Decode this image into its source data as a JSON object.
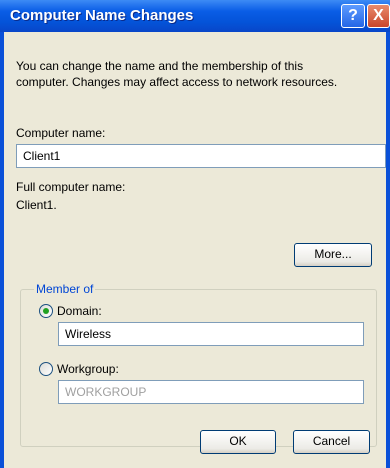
{
  "window": {
    "title": "Computer Name Changes",
    "help_label": "?",
    "close_label": "X"
  },
  "description": {
    "line1": "You can change the name and the membership of this",
    "line2": "computer. Changes may affect access to network resources."
  },
  "computer_name": {
    "label": "Computer name:",
    "value": "Client1"
  },
  "full_name": {
    "label": "Full computer name:",
    "value": "Client1."
  },
  "more_button": "More...",
  "member_of": {
    "title": "Member of",
    "domain": {
      "label": "Domain:",
      "value": "Wireless",
      "selected": true
    },
    "workgroup": {
      "label": "Workgroup:",
      "value": "WORKGROUP",
      "selected": false
    }
  },
  "buttons": {
    "ok": "OK",
    "cancel": "Cancel"
  }
}
